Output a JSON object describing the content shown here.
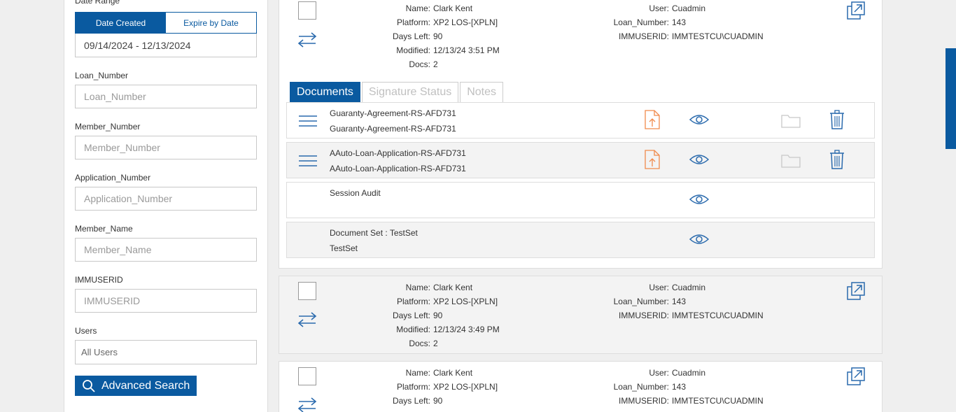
{
  "sidebar": {
    "date_range_label": "Date Range",
    "date_tabs": [
      "Date Created",
      "Expire by Date"
    ],
    "date_value": "09/14/2024 - 12/13/2024",
    "fields": [
      {
        "label": "Loan_Number",
        "placeholder": "Loan_Number"
      },
      {
        "label": "Member_Number",
        "placeholder": "Member_Number"
      },
      {
        "label": "Application_Number",
        "placeholder": "Application_Number"
      },
      {
        "label": "Member_Name",
        "placeholder": "Member_Name"
      },
      {
        "label": "IMMUSERID",
        "placeholder": "IMMUSERID"
      }
    ],
    "users_label": "Users",
    "users_value": "All Users",
    "advanced_search": "Advanced Search"
  },
  "cards": [
    {
      "name_k": "Name:",
      "name": "Clark Kent",
      "platform_k": "Platform:",
      "platform": "XP2 LOS-[XPLN]",
      "days_k": "Days Left:",
      "days": "90",
      "modified_k": "Modified:",
      "modified": "12/13/24 3:51 PM",
      "docs_k": "Docs:",
      "docs": "2",
      "user_k": "User:",
      "user": "Cuadmin",
      "loan_k": "Loan_Number:",
      "loan": "143",
      "imm_k": "IMMUSERID:",
      "imm": "IMMTESTCU\\CUADMIN"
    },
    {
      "name_k": "Name:",
      "name": "Clark Kent",
      "platform_k": "Platform:",
      "platform": "XP2 LOS-[XPLN]",
      "days_k": "Days Left:",
      "days": "90",
      "modified_k": "Modified:",
      "modified": "12/13/24 3:49 PM",
      "docs_k": "Docs:",
      "docs": "2",
      "user_k": "User:",
      "user": "Cuadmin",
      "loan_k": "Loan_Number:",
      "loan": "143",
      "imm_k": "IMMUSERID:",
      "imm": "IMMTESTCU\\CUADMIN"
    },
    {
      "name_k": "Name:",
      "name": "Clark Kent",
      "platform_k": "Platform:",
      "platform": "XP2 LOS-[XPLN]",
      "days_k": "Days Left:",
      "days": "90",
      "user_k": "User:",
      "user": "Cuadmin",
      "loan_k": "Loan_Number:",
      "loan": "143",
      "imm_k": "IMMUSERID:",
      "imm": "IMMTESTCU\\CUADMIN"
    }
  ],
  "tabs": [
    "Documents",
    "Signature Status",
    "Notes"
  ],
  "documents": [
    {
      "line1": "Guaranty-Agreement-RS-AFD731",
      "line2": "Guaranty-Agreement-RS-AFD731"
    },
    {
      "line1": "AAuto-Loan-Application-RS-AFD731",
      "line2": "AAuto-Loan-Application-RS-AFD731"
    },
    {
      "line1": "Session Audit",
      "line2": ""
    },
    {
      "line1": "Document Set : TestSet",
      "line2": "TestSet"
    }
  ],
  "colors": {
    "accent": "#0a5aa0",
    "upload": "#f08a4b"
  }
}
